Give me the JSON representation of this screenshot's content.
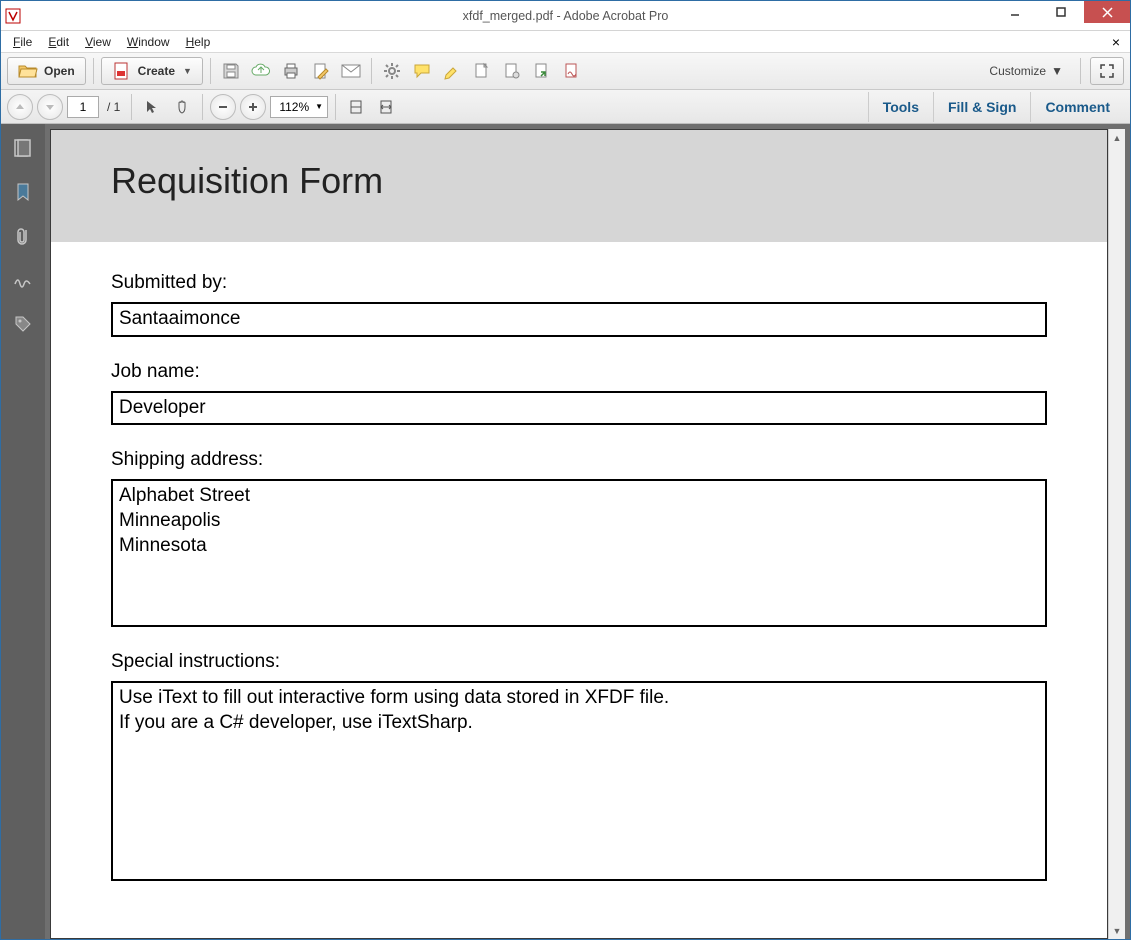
{
  "window": {
    "title": "xfdf_merged.pdf - Adobe Acrobat Pro"
  },
  "menubar": {
    "file": "File",
    "edit": "Edit",
    "view": "View",
    "window": "Window",
    "help": "Help"
  },
  "toolbar": {
    "open": "Open",
    "create": "Create",
    "customize": "Customize"
  },
  "toolbar2": {
    "page_current": "1",
    "page_total": "/ 1",
    "zoom": "112%"
  },
  "panels": {
    "tools": "Tools",
    "fill_sign": "Fill & Sign",
    "comment": "Comment"
  },
  "document": {
    "title": "Requisition Form",
    "submitted_by_label": "Submitted by:",
    "submitted_by_value": "Santaaimonce",
    "job_name_label": "Job name:",
    "job_name_value": "Developer",
    "shipping_label": "Shipping address:",
    "shipping_value": "Alphabet Street\nMinneapolis\nMinnesota",
    "instructions_label": "Special instructions:",
    "instructions_value": "Use iText to fill out interactive form using data stored in XFDF file.\nIf you are a C# developer, use iTextSharp."
  }
}
